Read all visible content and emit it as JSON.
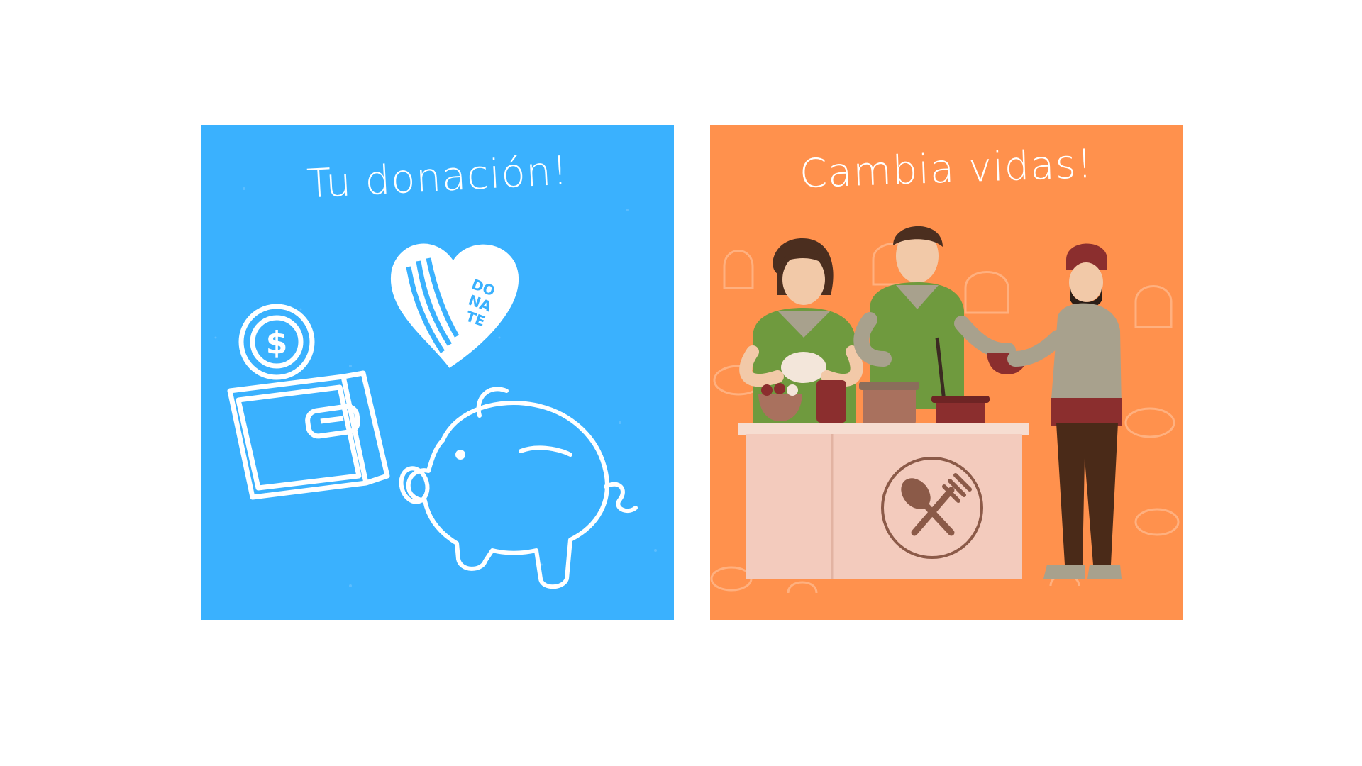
{
  "left_panel": {
    "headline": "Tu donación!",
    "icons": [
      "coin-icon",
      "wallet-icon",
      "heart-donate-icon",
      "piggy-bank-icon"
    ],
    "coin_symbol": "$",
    "heart_text": [
      "DO",
      "NA",
      "TE"
    ],
    "background_color": "#3AB1FE"
  },
  "right_panel": {
    "headline": "Cambia vidas!",
    "icons": [
      "spoon-fork-icon"
    ],
    "background_color": "#FF914D"
  }
}
